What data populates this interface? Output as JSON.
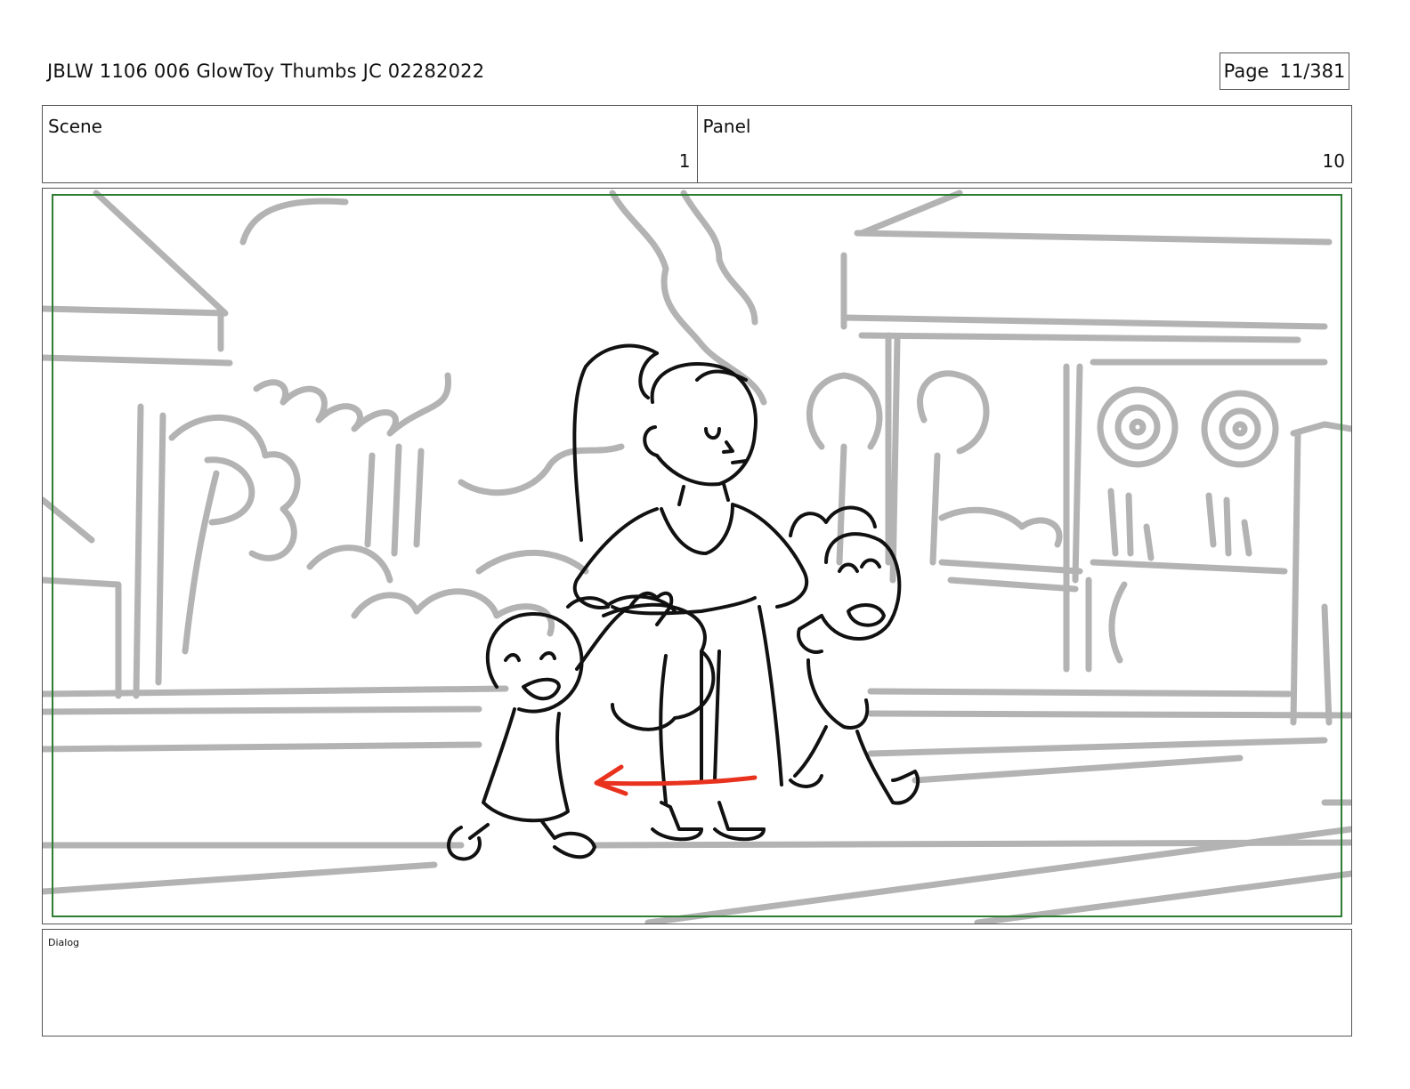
{
  "header": {
    "document_title": "JBLW 1106 006 GlowToy Thumbs JC 02282022",
    "page_label": "Page",
    "page_number": "11/381"
  },
  "info": {
    "scene_label": "Scene",
    "scene_value": "1",
    "panel_label": "Panel",
    "panel_value": "10"
  },
  "storyboard": {
    "safe_frame_color": "#2e7d32",
    "background_line_color": "#b3b3b3",
    "character_line_color": "#111111",
    "motion_arrow_color": "#e8321e",
    "content": "sketch-panel"
  },
  "dialog": {
    "label": "Dialog",
    "text": ""
  }
}
